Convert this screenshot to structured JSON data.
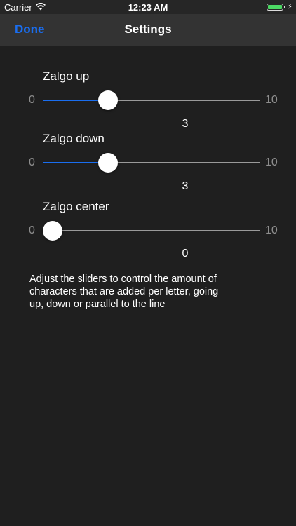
{
  "status_bar": {
    "carrier": "Carrier",
    "time": "12:23 AM",
    "battery_color": "#4cd964"
  },
  "nav": {
    "done_label": "Done",
    "title": "Settings",
    "accent_color": "#1a6ef0"
  },
  "sliders": [
    {
      "label": "Zalgo up",
      "min": "0",
      "max": "10",
      "value": 3,
      "value_text": "3"
    },
    {
      "label": "Zalgo down",
      "min": "0",
      "max": "10",
      "value": 3,
      "value_text": "3"
    },
    {
      "label": "Zalgo center",
      "min": "0",
      "max": "10",
      "value": 0,
      "value_text": "0"
    }
  ],
  "help_text": "Adjust the sliders to control the amount of characters that are added per letter, going up, down or parallel to the line"
}
